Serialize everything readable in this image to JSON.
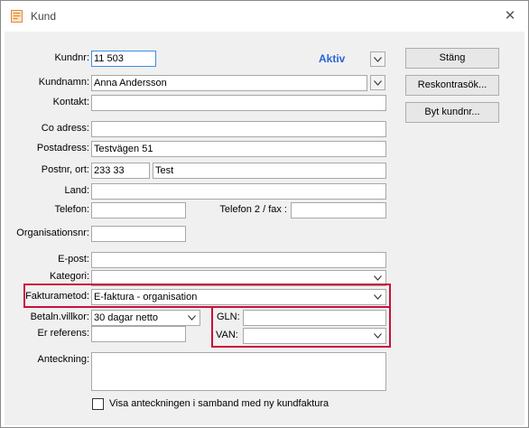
{
  "window": {
    "title": "Kund"
  },
  "labels": {
    "kundnr": "Kundnr:",
    "kundnamn": "Kundnamn:",
    "kontakt": "Kontakt:",
    "co_adress": "Co adress:",
    "postadress": "Postadress:",
    "postnr_ort": "Postnr, ort:",
    "land": "Land:",
    "telefon": "Telefon:",
    "telefon2": "Telefon 2 / fax :",
    "organisationsnr": "Organisationsnr:",
    "epost": "E-post:",
    "kategori": "Kategori:",
    "fakturametod": "Fakturametod:",
    "betalnvillkor": "Betaln.villkor:",
    "er_referens": "Er referens:",
    "gln": "GLN:",
    "van": "VAN:",
    "anteckning": "Anteckning:"
  },
  "values": {
    "kundnr": "11 503",
    "status": "Aktiv",
    "kundnamn": "Anna Andersson",
    "kontakt": "",
    "co_adress": "",
    "postadress": "Testvägen 51",
    "postnr": "233 33",
    "ort": "Test",
    "land": "",
    "telefon": "",
    "telefon2": "",
    "organisationsnr": "",
    "epost": "",
    "kategori": "",
    "fakturametod": "E-faktura - organisation",
    "betalnvillkor": "30 dagar netto",
    "er_referens": "",
    "gln": "",
    "van": "",
    "anteckning": ""
  },
  "buttons": {
    "stang": "Stäng",
    "reskontra": "Reskontrasök...",
    "byt_kundnr": "Byt kundnr..."
  },
  "checkbox": {
    "label": "Visa anteckningen i samband med ny kundfaktura",
    "checked": false
  },
  "colors": {
    "highlight": "#c8103b",
    "aktiv": "#2a64d8",
    "focus": "#3b8ee6"
  },
  "icons": {
    "app": "customer-card-icon",
    "close": "close-icon",
    "dropdown": "chevron-down-icon"
  }
}
